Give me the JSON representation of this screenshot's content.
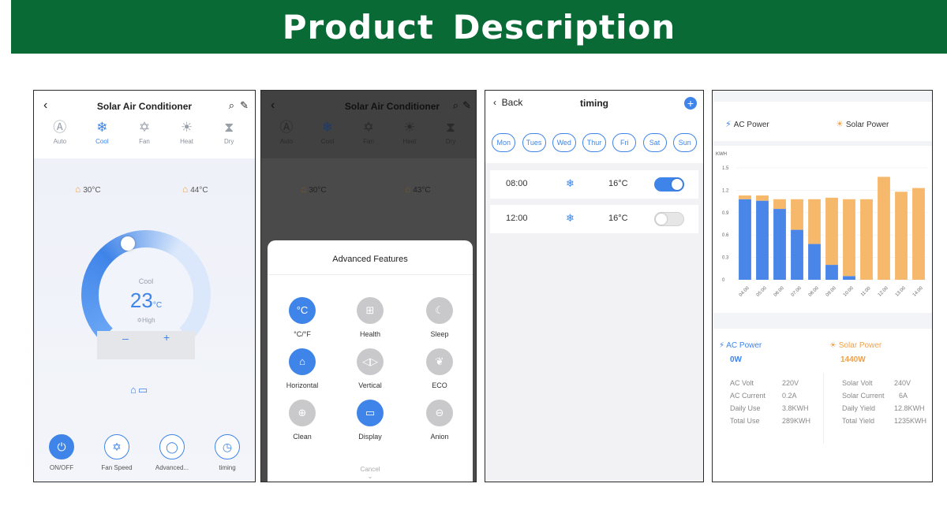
{
  "banner": {
    "title": "Product Description"
  },
  "screen1": {
    "header": {
      "back_icon": "chevron-left-icon",
      "title": "Solar Air Conditioner"
    },
    "modes": [
      {
        "label": "Auto",
        "icon": "auto-icon"
      },
      {
        "label": "Cool",
        "icon": "snowflake-icon",
        "active": true
      },
      {
        "label": "Fan",
        "icon": "fan-icon"
      },
      {
        "label": "Heat",
        "icon": "sun-icon"
      },
      {
        "label": "Dry",
        "icon": "droplet-icon"
      }
    ],
    "indoor_temp": "30°C",
    "outdoor_temp": "44°C",
    "dial": {
      "mode": "Cool",
      "temperature": "23",
      "unit": "°C",
      "fan": "High"
    },
    "bottom_bar": [
      {
        "label": "ON/OFF"
      },
      {
        "label": "Fan Speed"
      },
      {
        "label": "Advanced..."
      },
      {
        "label": "timing"
      }
    ]
  },
  "screen2": {
    "header": {
      "title": "Solar Air Conditioner"
    },
    "modes": [
      "Auto",
      "Cool",
      "Fan",
      "Heat",
      "Dry"
    ],
    "indoor_temp": "30°C",
    "outdoor_temp": "43°C",
    "sheet": {
      "title": "Advanced Features",
      "features": [
        {
          "label": "°C/°F",
          "glyph": "°C",
          "on": true
        },
        {
          "label": "Health",
          "glyph": "⊞",
          "on": false
        },
        {
          "label": "Sleep",
          "glyph": "☾",
          "on": false
        },
        {
          "label": "Horizontal",
          "glyph": "⌂",
          "on": true
        },
        {
          "label": "Vertical",
          "glyph": "◁▷",
          "on": false
        },
        {
          "label": "ECO",
          "glyph": "❦",
          "on": false
        },
        {
          "label": "Clean",
          "glyph": "⊕",
          "on": false
        },
        {
          "label": "Display",
          "glyph": "▭",
          "on": true
        },
        {
          "label": "Anion",
          "glyph": "⊖",
          "on": false
        }
      ],
      "cancel": "Cancel"
    }
  },
  "screen3": {
    "header": {
      "back": "Back",
      "title": "timing"
    },
    "days": [
      "Mon",
      "Tues",
      "Wed",
      "Thur",
      "Fri",
      "Sat",
      "Sun"
    ],
    "timers": [
      {
        "time": "08:00",
        "temp": "16°C",
        "enabled": true
      },
      {
        "time": "12:00",
        "temp": "16°C",
        "enabled": false
      }
    ]
  },
  "screen4": {
    "legend": {
      "ac": "AC Power",
      "solar": "Solar Power"
    },
    "colors": {
      "ac": "#4a86e8",
      "solar": "#f6b96b"
    },
    "chart_data": {
      "type": "bar",
      "ylabel": "KWH",
      "ylim": [
        0,
        1.5
      ],
      "yticks": [
        "1.5",
        "1.2",
        "0.9",
        "0.6",
        "0.3",
        "0"
      ],
      "categories": [
        "04:00",
        "05:00",
        "06:00",
        "07:00",
        "08:00",
        "09:00",
        "10:00",
        "11:00",
        "12:00",
        "13:00",
        "14:00"
      ],
      "series": [
        {
          "name": "AC Power",
          "values": [
            1.08,
            1.06,
            0.95,
            0.67,
            0.48,
            0.2,
            0.05,
            0,
            0,
            0,
            0
          ]
        },
        {
          "name": "Solar Power",
          "values": [
            0.05,
            0.07,
            0.13,
            0.41,
            0.6,
            0.9,
            1.03,
            1.08,
            1.38,
            1.18,
            1.23
          ]
        }
      ]
    },
    "ac_card": {
      "title": "AC Power",
      "value": "0W",
      "rows": [
        {
          "label": "AC Volt",
          "value": "220V"
        },
        {
          "label": "AC Current",
          "value": "0.2A"
        },
        {
          "label": "Daily Use",
          "value": "3.8KWH"
        },
        {
          "label": "Total Use",
          "value": "289KWH"
        }
      ]
    },
    "solar_card": {
      "title": "Solar Power",
      "value": "1440W",
      "rows": [
        {
          "label": "Solar Volt",
          "value": "240V"
        },
        {
          "label": "Solar Current",
          "value": "6A"
        },
        {
          "label": "Daily Yield",
          "value": "12.8KWH"
        },
        {
          "label": "Total Yield",
          "value": "1235KWH"
        }
      ]
    }
  }
}
